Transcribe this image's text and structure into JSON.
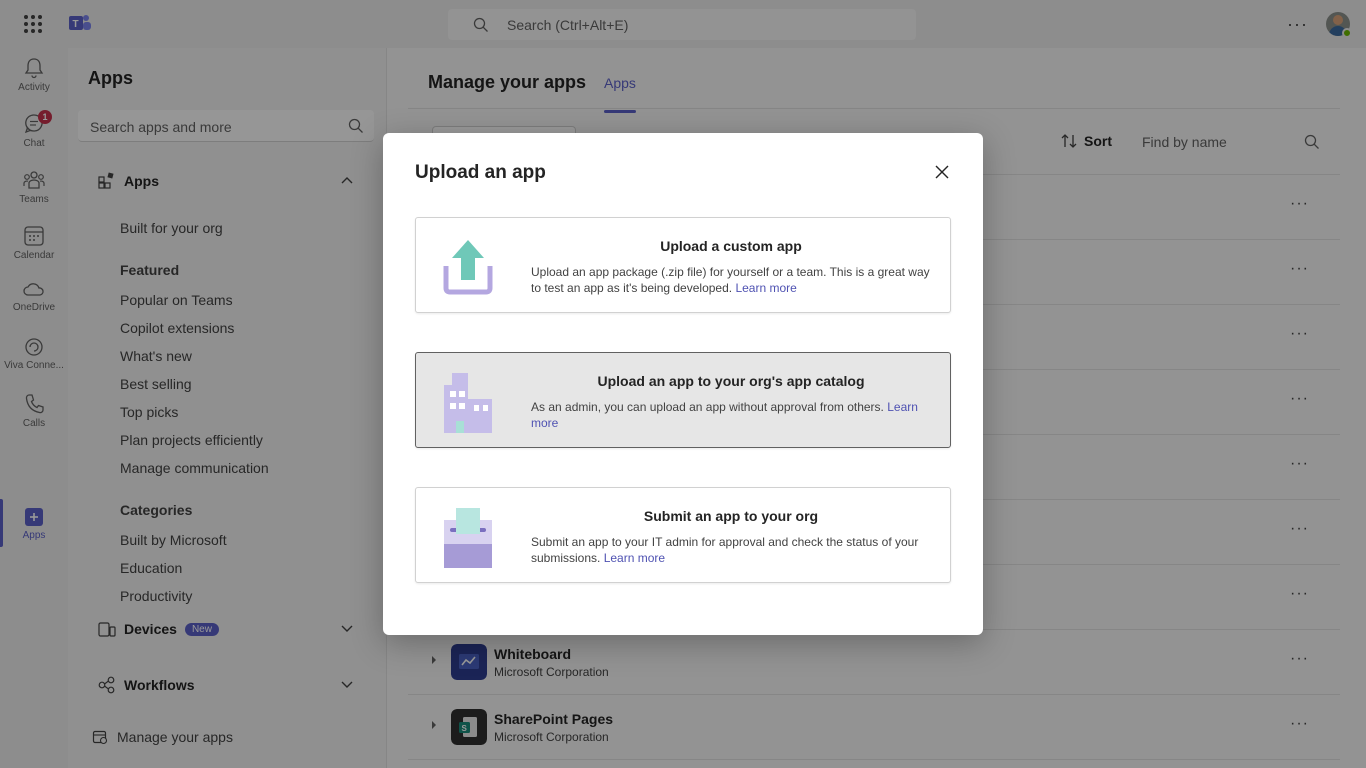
{
  "topbar": {
    "search_placeholder": "Search (Ctrl+Alt+E)"
  },
  "rail": {
    "items": [
      {
        "label": "Activity"
      },
      {
        "label": "Chat",
        "badge": "1"
      },
      {
        "label": "Teams"
      },
      {
        "label": "Calendar"
      },
      {
        "label": "OneDrive"
      },
      {
        "label": "Viva Conne..."
      },
      {
        "label": "Calls"
      },
      {
        "label": "Apps"
      }
    ]
  },
  "panel": {
    "title": "Apps",
    "search_placeholder": "Search apps and more",
    "apps_section": "Apps",
    "built_for_org": "Built for your org",
    "featured_heading": "Featured",
    "featured": [
      "Popular on Teams",
      "Copilot extensions",
      "What's new",
      "Best selling",
      "Top picks",
      "Plan projects efficiently",
      "Manage communication"
    ],
    "categories_heading": "Categories",
    "categories": [
      "Built by Microsoft",
      "Education",
      "Productivity"
    ],
    "devices_section": "Devices",
    "devices_badge": "New",
    "workflows_section": "Workflows",
    "manage_apps": "Manage your apps"
  },
  "main": {
    "title": "Manage your apps",
    "tab": "Apps",
    "sort_label": "Sort",
    "find_placeholder": "Find by name",
    "rows": [
      {
        "name": "Whiteboard",
        "publisher": "Microsoft Corporation"
      },
      {
        "name": "SharePoint Pages",
        "publisher": "Microsoft Corporation"
      }
    ]
  },
  "dialog": {
    "title": "Upload an app",
    "options": [
      {
        "title": "Upload a custom app",
        "desc": "Upload an app package (.zip file) for yourself or a team. This is a great way to test an app as it's being developed.",
        "link": "Learn more"
      },
      {
        "title": "Upload an app to your org's app catalog",
        "desc": "As an admin, you can upload an app without approval from others.",
        "link": "Learn more"
      },
      {
        "title": "Submit an app to your org",
        "desc": "Submit an app to your IT admin for approval and check the status of your submissions.",
        "link": "Learn more"
      }
    ]
  },
  "colors": {
    "accent": "#5b5fc7",
    "badge": "#c4314b",
    "link": "#4f52b2",
    "presence": "#6bb700"
  }
}
